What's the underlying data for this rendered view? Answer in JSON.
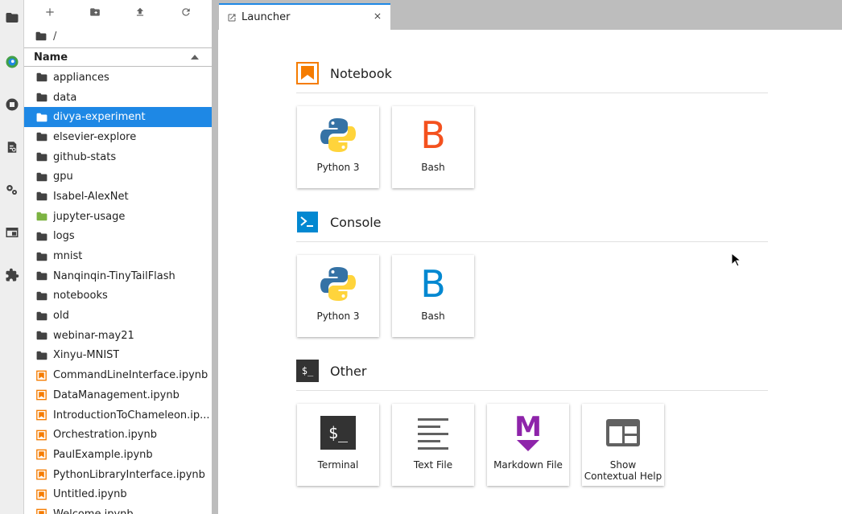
{
  "file_browser": {
    "breadcrumb": "/",
    "column_name": "Name",
    "items": [
      {
        "name": "appliances",
        "type": "folder"
      },
      {
        "name": "data",
        "type": "folder"
      },
      {
        "name": "divya-experiment",
        "type": "folder",
        "selected": true
      },
      {
        "name": "elsevier-explore",
        "type": "folder"
      },
      {
        "name": "github-stats",
        "type": "folder"
      },
      {
        "name": "gpu",
        "type": "folder"
      },
      {
        "name": "Isabel-AlexNet",
        "type": "folder"
      },
      {
        "name": "jupyter-usage",
        "type": "folder-green"
      },
      {
        "name": "logs",
        "type": "folder"
      },
      {
        "name": "mnist",
        "type": "folder"
      },
      {
        "name": "Nanqinqin-TinyTailFlash",
        "type": "folder"
      },
      {
        "name": "notebooks",
        "type": "folder"
      },
      {
        "name": "old",
        "type": "folder"
      },
      {
        "name": "webinar-may21",
        "type": "folder"
      },
      {
        "name": "Xinyu-MNIST",
        "type": "folder"
      },
      {
        "name": "CommandLineInterface.ipynb",
        "type": "notebook"
      },
      {
        "name": "DataManagement.ipynb",
        "type": "notebook"
      },
      {
        "name": "IntroductionToChameleon.ip...",
        "type": "notebook"
      },
      {
        "name": "Orchestration.ipynb",
        "type": "notebook"
      },
      {
        "name": "PaulExample.ipynb",
        "type": "notebook"
      },
      {
        "name": "PythonLibraryInterface.ipynb",
        "type": "notebook"
      },
      {
        "name": "Untitled.ipynb",
        "type": "notebook"
      },
      {
        "name": "Welcome.ipynb",
        "type": "notebook"
      }
    ]
  },
  "tab": {
    "label": "Launcher"
  },
  "launcher": {
    "notebook": {
      "title": "Notebook",
      "cards": [
        {
          "label": "Python 3"
        },
        {
          "label": "Bash"
        }
      ]
    },
    "console": {
      "title": "Console",
      "cards": [
        {
          "label": "Python 3"
        },
        {
          "label": "Bash"
        }
      ]
    },
    "other": {
      "title": "Other",
      "cards": [
        {
          "label": "Terminal"
        },
        {
          "label": "Text File"
        },
        {
          "label": "Markdown File"
        },
        {
          "label_line1": "Show",
          "label_line2": "Contextual Help"
        }
      ]
    }
  },
  "glyphs": {
    "bash_letter": "B",
    "markdown_letter": "M",
    "terminal_prompt": "$_"
  },
  "colors": {
    "accent": "#1e88e5",
    "notebook_orange": "#f57c00",
    "bash_orange": "#f4511e",
    "bash_blue": "#0288d1",
    "markdown_purple": "#8e24aa",
    "folder_gray": "#616161",
    "folder_green": "#7cb342"
  }
}
